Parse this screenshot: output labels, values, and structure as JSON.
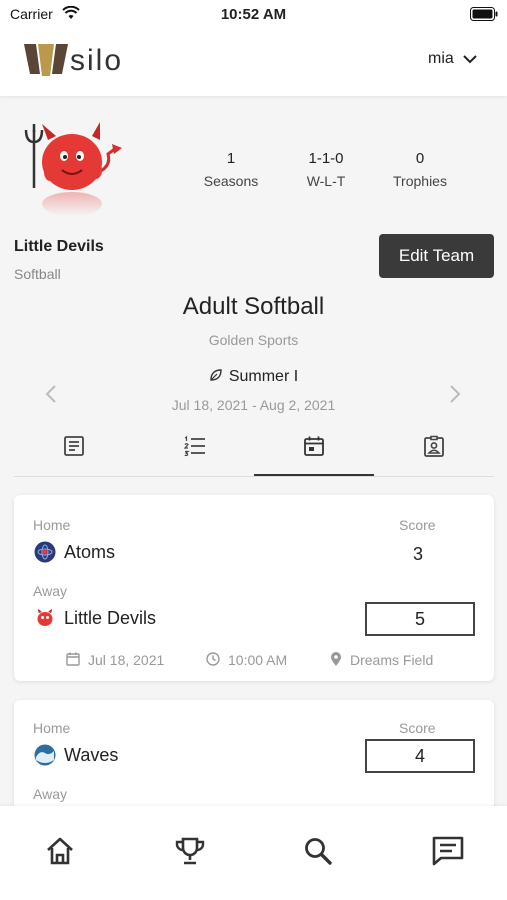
{
  "status_bar": {
    "carrier": "Carrier",
    "time": "10:52 AM"
  },
  "header": {
    "logo_text": "silo",
    "user_name": "mia"
  },
  "team": {
    "name": "Little Devils",
    "sport": "Softball",
    "edit_label": "Edit Team",
    "stats": [
      {
        "value": "1",
        "label": "Seasons"
      },
      {
        "value": "1-1-0",
        "label": "W-L-T"
      },
      {
        "value": "0",
        "label": "Trophies"
      }
    ]
  },
  "league": {
    "title": "Adult Softball",
    "organizer": "Golden Sports"
  },
  "season": {
    "name": "Summer I",
    "dates": "Jul 18, 2021 - Aug 2, 2021"
  },
  "tabs": [
    "news-icon",
    "standings-icon",
    "schedule-icon",
    "roster-icon"
  ],
  "games": [
    {
      "home_label": "Home",
      "away_label": "Away",
      "score_label": "Score",
      "home_team": "Atoms",
      "home_score": "3",
      "away_team": "Little Devils",
      "away_score": "5",
      "date": "Jul 18, 2021",
      "time": "10:00 AM",
      "location": "Dreams Field"
    },
    {
      "home_label": "Home",
      "away_label": "Away",
      "score_label": "Score",
      "home_team": "Waves",
      "home_score": "4"
    }
  ],
  "bottom_nav": [
    "home-icon",
    "trophy-icon",
    "search-icon",
    "chat-icon"
  ],
  "colors": {
    "primary_button": "#3a3a3a",
    "background": "#f5f5f5",
    "logo_gold": "#b99a4c",
    "logo_dark": "#5a4636"
  }
}
